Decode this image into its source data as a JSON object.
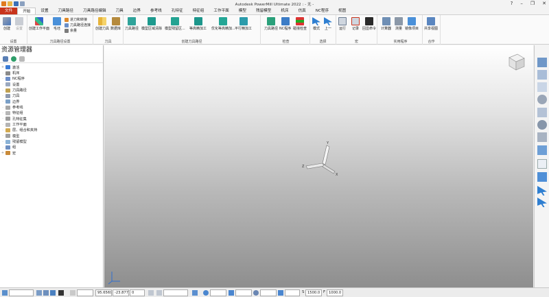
{
  "window": {
    "title": "Autodesk PowerMill Ultimate 2022  : - 无 -",
    "help_glyph": "?",
    "minimize_glyph": "–",
    "restore_glyph": "❐",
    "close_glyph": "✕"
  },
  "menu_tabs": [
    "文件",
    "开始",
    "设置",
    "刀具路径",
    "刀具路径编辑",
    "刀具",
    "边界",
    "参考线",
    "孔特征",
    "特征组",
    "工作平面",
    "模型",
    "残留模型",
    "机床",
    "仿真",
    "NC程序",
    "视图"
  ],
  "ribbon": {
    "group_setup": {
      "label": "设置",
      "create": "创建",
      "settings": "设置"
    },
    "group_toolpath_setup": {
      "label": "刀具路径设置",
      "create_workplane": "创建工作平面",
      "block": "毛坯",
      "rapid_moves": "进刀和转接",
      "toolpath_links": "刀具路径连接",
      "allowance": "余量"
    },
    "group_tool": {
      "label": "刀具",
      "create_tool": "创建刀具",
      "database": "数据库"
    },
    "group_create_toolpath": {
      "label": "创建刀具路径",
      "toolpath": "刀具路径",
      "model_area_clearance": "模型区域清除",
      "model_rest": "模型残留区...",
      "contour": "等高精加工",
      "optimized": "优化等高精加...",
      "flat_finishing": "平行精加工"
    },
    "group_verify": {
      "label": "检查",
      "toolpath": "刀具路径",
      "nc_program": "NC程序",
      "collision": "碰撞检查"
    },
    "group_select": {
      "label": "选择",
      "mode": "模式",
      "previous": "上一"
    },
    "group_macro": {
      "label": "宏",
      "run": "运行",
      "record": "记录",
      "echo": "回显命令"
    },
    "group_utilities": {
      "label": "实用程序",
      "calculator": "计算器",
      "measure": "测量",
      "mirror_project": "镜像项目"
    },
    "group_collaborate": {
      "label": "合作",
      "share_view": "共享视图"
    }
  },
  "explorer": {
    "title": "资源管理器",
    "tree": [
      {
        "label": "激活",
        "color": "#3a7bd5"
      },
      {
        "label": "机床",
        "color": "#8a8a8a"
      },
      {
        "label": "NC程序",
        "color": "#6d8ec9"
      },
      {
        "label": "设置",
        "color": "#9aa8bf"
      },
      {
        "label": "刀具路径",
        "color": "#c0a050"
      },
      {
        "label": "刀具",
        "color": "#8f9aaf"
      },
      {
        "label": "边界",
        "color": "#7aa0c8"
      },
      {
        "label": "参考线",
        "color": "#a7a7a7"
      },
      {
        "label": "特征组",
        "color": "#b7b7b7"
      },
      {
        "label": "孔特征集",
        "color": "#9c9c9c"
      },
      {
        "label": "工作平面",
        "color": "#b5b5b5"
      },
      {
        "label": "层、组合和夹持",
        "color": "#d2a94f"
      },
      {
        "label": "模型",
        "color": "#a0a0a0"
      },
      {
        "label": "残留模型",
        "color": "#8ab2d6"
      },
      {
        "label": "组",
        "color": "#6e8fc1"
      },
      {
        "label": "宏",
        "color": "#c98b3a"
      }
    ]
  },
  "viewport": {
    "axis_x": "X",
    "axis_y": "Y",
    "axis_z": "Z"
  },
  "statusbar": {
    "x": "95.6569",
    "y": "-23.877",
    "z": "0",
    "s_label": "S",
    "s_value": "1500.0",
    "f_label": "F",
    "f_value": "1000.0"
  },
  "colors": {
    "file_tab": "#c8341c",
    "accent_blue": "#2f7fd1",
    "teal": "#1d9a8e"
  }
}
